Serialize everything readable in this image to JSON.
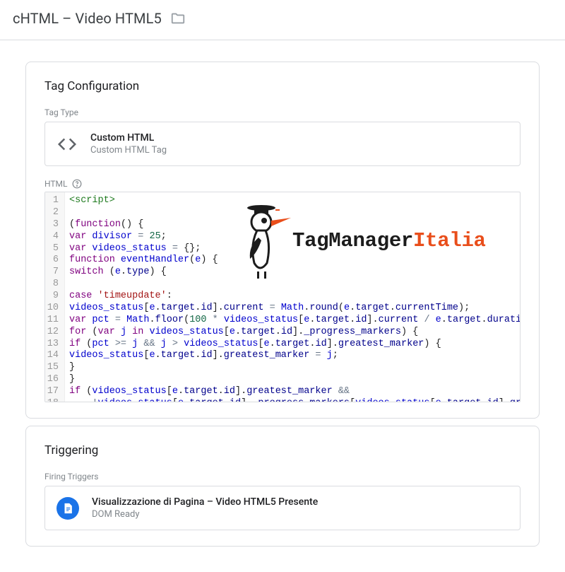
{
  "header": {
    "title": "cHTML – Video HTML5"
  },
  "tagConfig": {
    "title": "Tag Configuration",
    "typeLabel": "Tag Type",
    "type": {
      "primary": "Custom HTML",
      "secondary": "Custom HTML Tag"
    },
    "htmlLabel": "HTML",
    "codeLines": [
      [
        {
          "c": "tok-tag",
          "t": "<script>"
        }
      ],
      [
        {
          "t": ""
        }
      ],
      [
        {
          "t": "("
        },
        {
          "c": "tok-kw",
          "t": "function"
        },
        {
          "t": "() {"
        }
      ],
      [
        {
          "c": "tok-kw",
          "t": "var"
        },
        {
          "t": " "
        },
        {
          "c": "tok-var",
          "t": "divisor"
        },
        {
          "t": " "
        },
        {
          "c": "tok-op",
          "t": "="
        },
        {
          "t": " "
        },
        {
          "c": "tok-num",
          "t": "25"
        },
        {
          "t": ";"
        }
      ],
      [
        {
          "c": "tok-kw",
          "t": "var"
        },
        {
          "t": " "
        },
        {
          "c": "tok-var",
          "t": "videos_status"
        },
        {
          "t": " "
        },
        {
          "c": "tok-op",
          "t": "="
        },
        {
          "t": " {};"
        }
      ],
      [
        {
          "c": "tok-kw",
          "t": "function"
        },
        {
          "t": " "
        },
        {
          "c": "tok-var",
          "t": "eventHandler"
        },
        {
          "t": "("
        },
        {
          "c": "tok-var",
          "t": "e"
        },
        {
          "t": ") {"
        }
      ],
      [
        {
          "c": "tok-kw",
          "t": "switch"
        },
        {
          "t": " ("
        },
        {
          "c": "tok-var",
          "t": "e"
        },
        {
          "t": "."
        },
        {
          "c": "tok-prop",
          "t": "type"
        },
        {
          "t": ") {"
        }
      ],
      [
        {
          "t": ""
        }
      ],
      [
        {
          "c": "tok-kw",
          "t": "case"
        },
        {
          "t": " "
        },
        {
          "c": "tok-str",
          "t": "'timeupdate'"
        },
        {
          "t": ":"
        }
      ],
      [
        {
          "c": "tok-var",
          "t": "videos_status"
        },
        {
          "t": "["
        },
        {
          "c": "tok-var",
          "t": "e"
        },
        {
          "t": "."
        },
        {
          "c": "tok-prop",
          "t": "target"
        },
        {
          "t": "."
        },
        {
          "c": "tok-prop",
          "t": "id"
        },
        {
          "t": "]."
        },
        {
          "c": "tok-prop",
          "t": "current"
        },
        {
          "t": " "
        },
        {
          "c": "tok-op",
          "t": "="
        },
        {
          "t": " "
        },
        {
          "c": "tok-var",
          "t": "Math"
        },
        {
          "t": "."
        },
        {
          "c": "tok-prop",
          "t": "round"
        },
        {
          "t": "("
        },
        {
          "c": "tok-var",
          "t": "e"
        },
        {
          "t": "."
        },
        {
          "c": "tok-prop",
          "t": "target"
        },
        {
          "t": "."
        },
        {
          "c": "tok-prop",
          "t": "currentTime"
        },
        {
          "t": ");"
        }
      ],
      [
        {
          "c": "tok-kw",
          "t": "var"
        },
        {
          "t": " "
        },
        {
          "c": "tok-var",
          "t": "pct"
        },
        {
          "t": " "
        },
        {
          "c": "tok-op",
          "t": "="
        },
        {
          "t": " "
        },
        {
          "c": "tok-var",
          "t": "Math"
        },
        {
          "t": "."
        },
        {
          "c": "tok-prop",
          "t": "floor"
        },
        {
          "t": "("
        },
        {
          "c": "tok-num",
          "t": "100"
        },
        {
          "t": " "
        },
        {
          "c": "tok-op",
          "t": "*"
        },
        {
          "t": " "
        },
        {
          "c": "tok-var",
          "t": "videos_status"
        },
        {
          "t": "["
        },
        {
          "c": "tok-var",
          "t": "e"
        },
        {
          "t": "."
        },
        {
          "c": "tok-prop",
          "t": "target"
        },
        {
          "t": "."
        },
        {
          "c": "tok-prop",
          "t": "id"
        },
        {
          "t": "]."
        },
        {
          "c": "tok-prop",
          "t": "current"
        },
        {
          "t": " "
        },
        {
          "c": "tok-op",
          "t": "/"
        },
        {
          "t": " "
        },
        {
          "c": "tok-var",
          "t": "e"
        },
        {
          "t": "."
        },
        {
          "c": "tok-prop",
          "t": "target"
        },
        {
          "t": "."
        },
        {
          "c": "tok-prop",
          "t": "duration"
        },
        {
          "t": ");"
        }
      ],
      [
        {
          "c": "tok-kw",
          "t": "for"
        },
        {
          "t": " ("
        },
        {
          "c": "tok-kw",
          "t": "var"
        },
        {
          "t": " "
        },
        {
          "c": "tok-var",
          "t": "j"
        },
        {
          "t": " "
        },
        {
          "c": "tok-kw",
          "t": "in"
        },
        {
          "t": " "
        },
        {
          "c": "tok-var",
          "t": "videos_status"
        },
        {
          "t": "["
        },
        {
          "c": "tok-var",
          "t": "e"
        },
        {
          "t": "."
        },
        {
          "c": "tok-prop",
          "t": "target"
        },
        {
          "t": "."
        },
        {
          "c": "tok-prop",
          "t": "id"
        },
        {
          "t": "]."
        },
        {
          "c": "tok-prop",
          "t": "_progress_markers"
        },
        {
          "t": ") {"
        }
      ],
      [
        {
          "c": "tok-kw",
          "t": "if"
        },
        {
          "t": " ("
        },
        {
          "c": "tok-var",
          "t": "pct"
        },
        {
          "t": " "
        },
        {
          "c": "tok-op",
          "t": ">="
        },
        {
          "t": " "
        },
        {
          "c": "tok-var",
          "t": "j"
        },
        {
          "t": " "
        },
        {
          "c": "tok-op",
          "t": "&&"
        },
        {
          "t": " "
        },
        {
          "c": "tok-var",
          "t": "j"
        },
        {
          "t": " "
        },
        {
          "c": "tok-op",
          "t": ">"
        },
        {
          "t": " "
        },
        {
          "c": "tok-var",
          "t": "videos_status"
        },
        {
          "t": "["
        },
        {
          "c": "tok-var",
          "t": "e"
        },
        {
          "t": "."
        },
        {
          "c": "tok-prop",
          "t": "target"
        },
        {
          "t": "."
        },
        {
          "c": "tok-prop",
          "t": "id"
        },
        {
          "t": "]."
        },
        {
          "c": "tok-prop",
          "t": "greatest_marker"
        },
        {
          "t": ") {"
        }
      ],
      [
        {
          "c": "tok-var",
          "t": "videos_status"
        },
        {
          "t": "["
        },
        {
          "c": "tok-var",
          "t": "e"
        },
        {
          "t": "."
        },
        {
          "c": "tok-prop",
          "t": "target"
        },
        {
          "t": "."
        },
        {
          "c": "tok-prop",
          "t": "id"
        },
        {
          "t": "]."
        },
        {
          "c": "tok-prop",
          "t": "greatest_marker"
        },
        {
          "t": " "
        },
        {
          "c": "tok-op",
          "t": "="
        },
        {
          "t": " "
        },
        {
          "c": "tok-var",
          "t": "j"
        },
        {
          "t": ";"
        }
      ],
      [
        {
          "t": "}"
        }
      ],
      [
        {
          "t": "}"
        }
      ],
      [
        {
          "c": "tok-kw",
          "t": "if"
        },
        {
          "t": " ("
        },
        {
          "c": "tok-var",
          "t": "videos_status"
        },
        {
          "t": "["
        },
        {
          "c": "tok-var",
          "t": "e"
        },
        {
          "t": "."
        },
        {
          "c": "tok-prop",
          "t": "target"
        },
        {
          "t": "."
        },
        {
          "c": "tok-prop",
          "t": "id"
        },
        {
          "t": "]."
        },
        {
          "c": "tok-prop",
          "t": "greatest_marker"
        },
        {
          "t": " "
        },
        {
          "c": "tok-op",
          "t": "&&"
        }
      ],
      [
        {
          "t": "    "
        },
        {
          "c": "tok-op",
          "t": "!"
        },
        {
          "c": "tok-var",
          "t": "videos_status"
        },
        {
          "t": "["
        },
        {
          "c": "tok-var",
          "t": "e"
        },
        {
          "t": "."
        },
        {
          "c": "tok-prop",
          "t": "target"
        },
        {
          "t": "."
        },
        {
          "c": "tok-prop",
          "t": "id"
        },
        {
          "t": "]."
        },
        {
          "c": "tok-prop",
          "t": "_progress_markers"
        },
        {
          "t": "["
        },
        {
          "c": "tok-var",
          "t": "videos_status"
        },
        {
          "t": "["
        },
        {
          "c": "tok-var",
          "t": "e"
        },
        {
          "t": "."
        },
        {
          "c": "tok-prop",
          "t": "target"
        },
        {
          "t": "."
        },
        {
          "c": "tok-prop",
          "t": "id"
        },
        {
          "t": "]."
        },
        {
          "c": "tok-prop",
          "t": "greatest_marker"
        },
        {
          "t": "]) {"
        }
      ]
    ]
  },
  "triggering": {
    "title": "Triggering",
    "firingLabel": "Firing Triggers",
    "trigger": {
      "primary": "Visualizzazione di Pagina – Video HTML5 Presente",
      "secondary": "DOM Ready"
    }
  },
  "watermark": {
    "text1": "TagManager",
    "text2": "Italia"
  }
}
